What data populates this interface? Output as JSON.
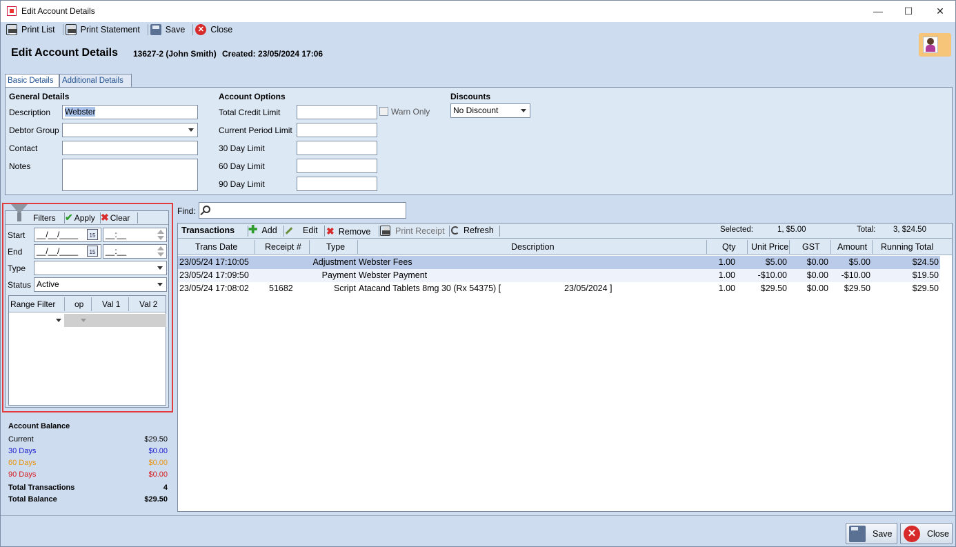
{
  "window": {
    "title": "Edit Account Details"
  },
  "toolbar": {
    "print_list": "Print List",
    "print_statement": "Print Statement",
    "save": "Save",
    "close": "Close"
  },
  "header": {
    "title": "Edit Account Details",
    "account": "13627-2 (John Smith)",
    "created": "Created: 23/05/2024 17:06"
  },
  "tabs": [
    "Basic Details",
    "Additional Details"
  ],
  "general": {
    "heading": "General Details",
    "description_label": "Description",
    "description_value": "Webster",
    "debtor_group_label": "Debtor Group",
    "debtor_group_value": "",
    "contact_label": "Contact",
    "contact_value": "",
    "notes_label": "Notes",
    "notes_value": ""
  },
  "account_options": {
    "heading": "Account Options",
    "total_credit_limit": "Total Credit Limit",
    "warn_only": "Warn Only",
    "current_period_limit": "Current Period Limit",
    "day30": "30 Day Limit",
    "day60": "60 Day Limit",
    "day90": "90 Day Limit"
  },
  "discounts": {
    "heading": "Discounts",
    "value": "No Discount"
  },
  "filters": {
    "label": "Filters",
    "apply": "Apply",
    "clear": "Clear",
    "start_label": "Start",
    "start_date": "__/__/____",
    "start_time": "__:__",
    "end_label": "End",
    "end_date": "__/__/____",
    "end_time": "__:__",
    "type_label": "Type",
    "type_value": "",
    "status_label": "Status",
    "status_value": "Active",
    "range_headers": [
      "Range Filter",
      "op",
      "Val 1",
      "Val 2"
    ]
  },
  "balance": {
    "heading": "Account Balance",
    "rows": [
      {
        "label": "Current",
        "value": "$29.50",
        "color": "#000000"
      },
      {
        "label": "30 Days",
        "value": "$0.00",
        "color": "#1a1acc"
      },
      {
        "label": "60 Days",
        "value": "$0.00",
        "color": "#e8940c"
      },
      {
        "label": "90 Days",
        "value": "$0.00",
        "color": "#d61a1a"
      }
    ],
    "total_transactions_label": "Total Transactions",
    "total_transactions": "4",
    "total_balance_label": "Total Balance",
    "total_balance": "$29.50"
  },
  "find": {
    "label": "Find:"
  },
  "transactions": {
    "title": "Transactions",
    "add": "Add",
    "edit": "Edit",
    "remove": "Remove",
    "print_receipt": "Print Receipt",
    "refresh": "Refresh",
    "selected_label": "Selected:",
    "selected_value": "1, $5.00",
    "total_label": "Total:",
    "total_value": "3, $24.50",
    "columns": [
      "Trans Date",
      "Receipt #",
      "Type",
      "Description",
      "Qty",
      "Unit Price",
      "GST",
      "Amount",
      "Running Total"
    ],
    "rows": [
      {
        "date": "23/05/24 17:10:05",
        "receipt": "",
        "type": "Adjustment",
        "desc": "Webster Fees",
        "desc2": "",
        "qty": "1.00",
        "unit": "$5.00",
        "gst": "$0.00",
        "amount": "$5.00",
        "running": "$24.50"
      },
      {
        "date": "23/05/24 17:09:50",
        "receipt": "",
        "type": "Payment",
        "desc": "Webster Payment",
        "desc2": "",
        "qty": "1.00",
        "unit": "-$10.00",
        "gst": "$0.00",
        "amount": "-$10.00",
        "running": "$19.50"
      },
      {
        "date": "23/05/24 17:08:02",
        "receipt": "51682",
        "type": "Script",
        "desc": "Atacand Tablets 8mg 30 (Rx 54375)  [",
        "desc2": "23/05/2024 ]",
        "qty": "1.00",
        "unit": "$29.50",
        "gst": "$0.00",
        "amount": "$29.50",
        "running": "$29.50"
      }
    ]
  },
  "footer": {
    "save": "Save",
    "close": "Close"
  }
}
